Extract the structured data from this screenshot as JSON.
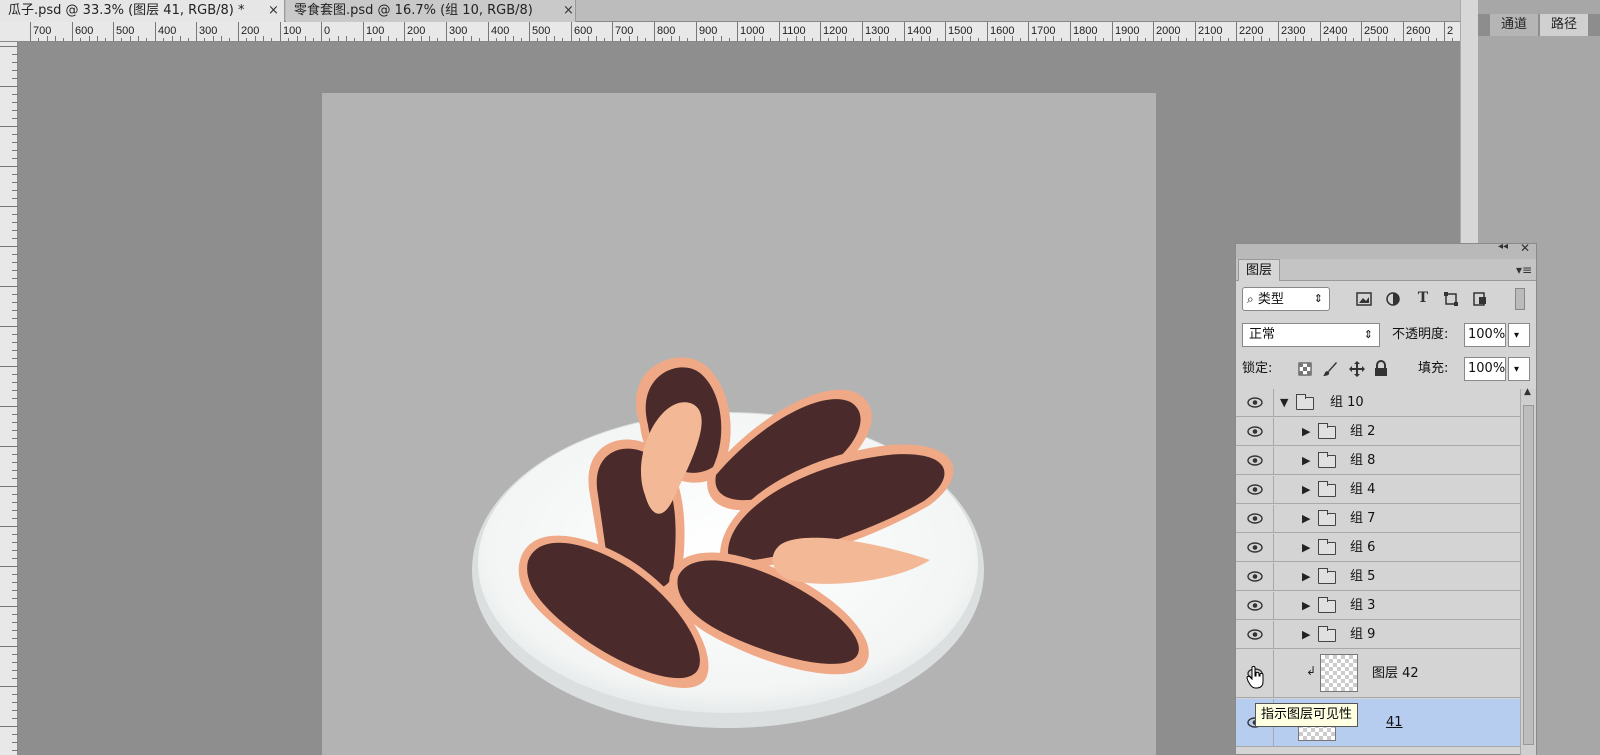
{
  "doc_tabs": [
    {
      "title": "瓜子.psd @ 33.3% (图层 41, RGB/8) *",
      "close": "×"
    },
    {
      "title": "零食套图.psd @ 16.7% (组 10, RGB/8)",
      "close": "×"
    }
  ],
  "ruler": {
    "h_labels": [
      "700",
      "600",
      "500",
      "400",
      "300",
      "200",
      "100",
      "0",
      "100",
      "200",
      "300",
      "400",
      "500",
      "600",
      "700",
      "800",
      "900",
      "1000",
      "1100",
      "1200",
      "1300",
      "1400",
      "1500",
      "1600",
      "1700",
      "1800",
      "1900",
      "2000",
      "2100",
      "2200",
      "2300",
      "2400",
      "2500",
      "2600",
      "2"
    ]
  },
  "dock_tabs": [
    "通道",
    "路径"
  ],
  "layers_panel": {
    "tab_label": "图层",
    "header_icons": [
      "collapse-icon",
      "close-icon",
      "panel-menu-icon"
    ],
    "filter": {
      "icon": "search-icon",
      "value": "类型",
      "arrows": "⇕"
    },
    "filter_icons": [
      "image-filter-icon",
      "adjustment-filter-icon",
      "text-filter-icon",
      "shape-filter-icon",
      "smart-object-filter-icon"
    ],
    "blend_mode": "正常",
    "opacity_label": "不透明度:",
    "opacity_value": "100%",
    "lock_label": "锁定:",
    "lock_icons": [
      "lock-transparent-icon",
      "lock-paint-icon",
      "lock-move-icon",
      "lock-all-icon"
    ],
    "fill_label": "填充:",
    "fill_value": "100%",
    "dropdown_arrow": "▾",
    "layers": [
      {
        "name": "组 10",
        "type": "group",
        "expanded": true,
        "indent": 0
      },
      {
        "name": "组 2",
        "type": "group",
        "expanded": false,
        "indent": 1
      },
      {
        "name": "组 8",
        "type": "group",
        "expanded": false,
        "indent": 1
      },
      {
        "name": "组 4",
        "type": "group",
        "expanded": false,
        "indent": 1
      },
      {
        "name": "组 7",
        "type": "group",
        "expanded": false,
        "indent": 1
      },
      {
        "name": "组 6",
        "type": "group",
        "expanded": false,
        "indent": 1
      },
      {
        "name": "组 5",
        "type": "group",
        "expanded": false,
        "indent": 1
      },
      {
        "name": "组 3",
        "type": "group",
        "expanded": false,
        "indent": 1
      },
      {
        "name": "组 9",
        "type": "group",
        "expanded": false,
        "indent": 1
      },
      {
        "name": "图层 42",
        "type": "layer",
        "clipped": true,
        "indent": 1
      },
      {
        "name": "41",
        "type": "layer",
        "selected": true,
        "indent": 1
      }
    ]
  },
  "tooltip": "指示图层可见性",
  "colors": {
    "selection": "#b6cdef",
    "canvas": "#b3b3b3",
    "workspace": "#8e8e8e"
  }
}
